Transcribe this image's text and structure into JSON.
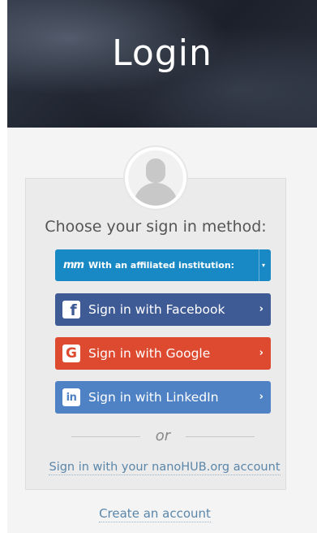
{
  "hero": {
    "title": "Login"
  },
  "signin": {
    "prompt": "Choose your sign in method:",
    "institution": {
      "logo_text": "mm",
      "label": "With an affiliated institution:"
    },
    "facebook": {
      "icon_char": "f",
      "label": "Sign in with Facebook"
    },
    "google": {
      "icon_char": "G",
      "label": "Sign in with Google"
    },
    "linkedin": {
      "icon_char": "in",
      "label": "Sign in with LinkedIn"
    },
    "chevron": "›",
    "or_text": "or",
    "hub_account_link": "Sign in with your nanoHUB.org account"
  },
  "create_account_link": "Create an account",
  "colors": {
    "institution": "#1989c5",
    "facebook": "#3f5b96",
    "google": "#dd4a30",
    "linkedin": "#4f82c4",
    "link": "#5a86aa"
  },
  "icons": {
    "avatar": "user-silhouette-icon",
    "facebook": "facebook-icon",
    "google": "google-icon",
    "linkedin": "linkedin-icon",
    "institution": "institution-logo-icon"
  }
}
